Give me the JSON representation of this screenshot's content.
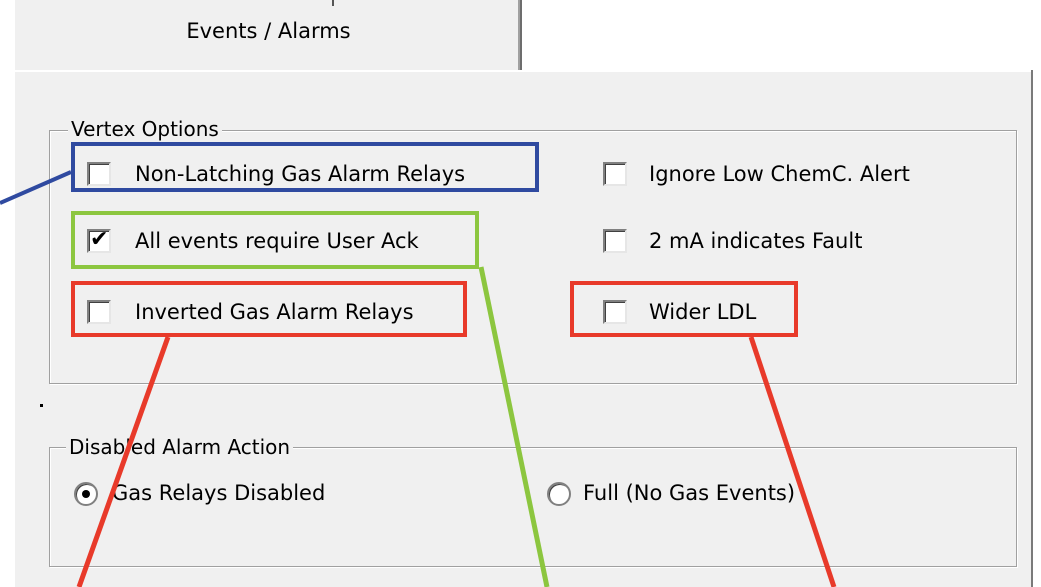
{
  "tab": {
    "label": "Events / Alarms"
  },
  "vertex_options": {
    "title": "Vertex  Options",
    "left": [
      {
        "label": "Non-Latching Gas Alarm Relays",
        "checked": false
      },
      {
        "label": "All events require User Ack",
        "checked": true
      },
      {
        "label": "Inverted Gas Alarm Relays",
        "checked": false
      }
    ],
    "right": [
      {
        "label": "Ignore Low ChemC. Alert",
        "checked": false
      },
      {
        "label": "2 mA indicates Fault",
        "checked": false
      },
      {
        "label": "Wider LDL",
        "checked": false
      }
    ]
  },
  "disabled_alarm_action": {
    "title": "Disabled Alarm Action",
    "options": [
      {
        "label": "Gas Relays Disabled",
        "selected": true
      },
      {
        "label": "Full (No Gas Events)",
        "selected": false
      }
    ]
  },
  "annotation_colors": {
    "blue": "#2f4aa0",
    "green": "#8cc63f",
    "red": "#e83a2a"
  }
}
